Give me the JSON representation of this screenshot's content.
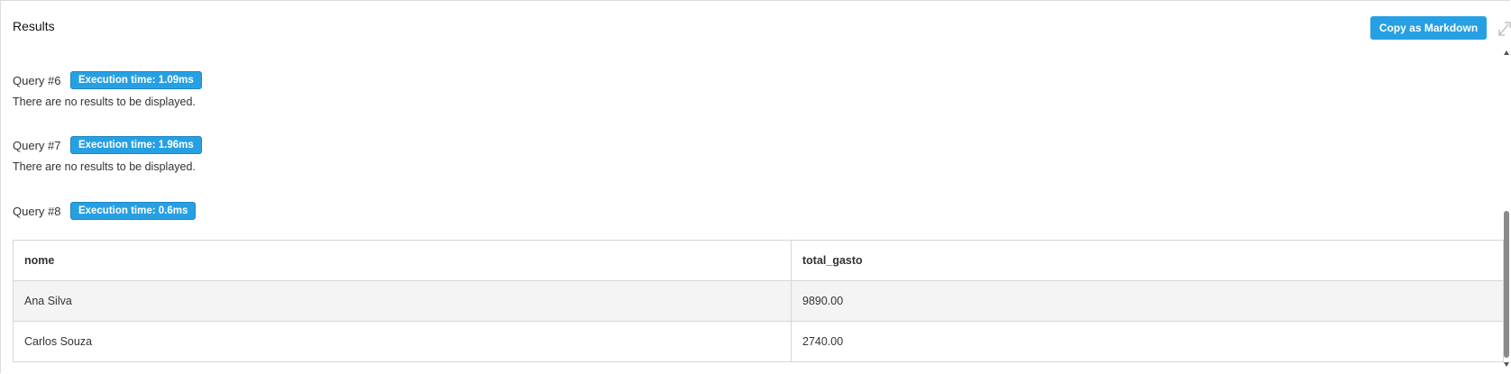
{
  "header": {
    "title": "Results",
    "copy_button": "Copy as Markdown"
  },
  "queries": [
    {
      "label": "Query #6",
      "badge": "Execution time: 1.09ms",
      "message": "There are no results to be displayed."
    },
    {
      "label": "Query #7",
      "badge": "Execution time: 1.96ms",
      "message": "There are no results to be displayed."
    },
    {
      "label": "Query #8",
      "badge": "Execution time: 0.6ms"
    }
  ],
  "table": {
    "columns": [
      "nome",
      "total_gasto"
    ],
    "rows": [
      [
        "Ana Silva",
        "9890.00"
      ],
      [
        "Carlos Souza",
        "2740.00"
      ]
    ]
  },
  "colors": {
    "accent": "#27a0e3"
  },
  "icons": {
    "expand": "expand-icon"
  }
}
